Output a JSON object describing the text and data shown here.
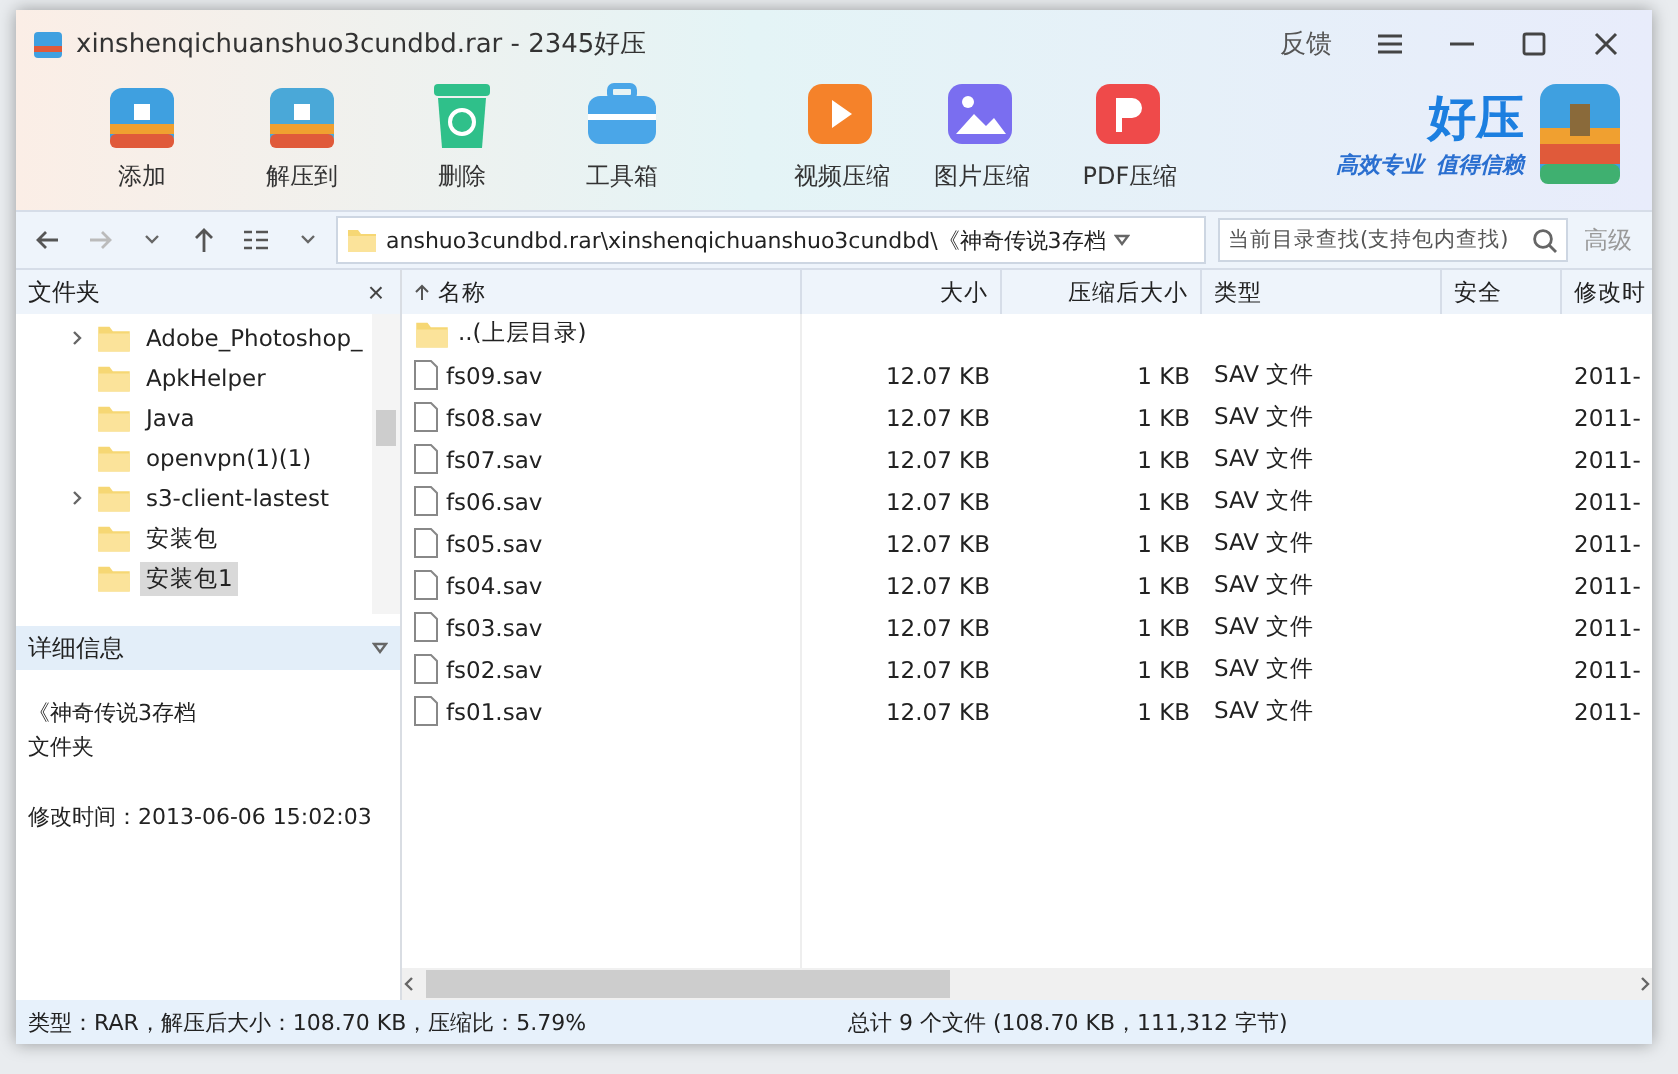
{
  "window": {
    "title": "xinshenqichuanshuo3cundbd.rar - 2345好压",
    "feedback": "反馈"
  },
  "toolbar": [
    {
      "label": "添加",
      "kind": "box",
      "color": "#3fa0e0"
    },
    {
      "label": "解压到",
      "kind": "box",
      "color": "#4aa8d8"
    },
    {
      "label": "删除",
      "kind": "bin",
      "color": "#2fc08a"
    },
    {
      "label": "工具箱",
      "kind": "case",
      "color": "#4aa6e8"
    },
    {
      "label": "视频压缩",
      "kind": "video",
      "color": "#f5822a"
    },
    {
      "label": "图片压缩",
      "kind": "image",
      "color": "#7a6ef0"
    },
    {
      "label": "PDF压缩",
      "kind": "pdf",
      "color": "#ef4a4a"
    }
  ],
  "brand": {
    "name": "好压",
    "slogan_1": "高效专业",
    "slogan_2": "值得信赖"
  },
  "address": {
    "path": "anshuo3cundbd.rar\\xinshenqichuanshuo3cundbd\\《神奇传说3存档",
    "search_placeholder": "当前目录查找(支持包内查找)",
    "advanced": "高级"
  },
  "folder_pane": {
    "title": "文件夹",
    "close": "×",
    "items": [
      {
        "label": "Adobe_Photoshop_",
        "expandable": true,
        "selected": false
      },
      {
        "label": "ApkHelper",
        "expandable": false,
        "selected": false
      },
      {
        "label": "Java",
        "expandable": false,
        "selected": false
      },
      {
        "label": "openvpn(1)(1)",
        "expandable": false,
        "selected": false
      },
      {
        "label": "s3-client-lastest",
        "expandable": true,
        "selected": false
      },
      {
        "label": "安装包",
        "expandable": false,
        "selected": false
      },
      {
        "label": "安装包1",
        "expandable": false,
        "selected": true
      }
    ]
  },
  "details": {
    "title": "详细信息",
    "name": "《神奇传说3存档",
    "type": "文件夹",
    "modified": "修改时间：2013-06-06 15:02:03"
  },
  "table": {
    "columns": [
      "名称",
      "大小",
      "压缩后大小",
      "类型",
      "安全",
      "修改时"
    ],
    "rows": [
      {
        "kind": "parent",
        "name": "..(上层目录)"
      },
      {
        "kind": "file",
        "name": "fs09.sav",
        "size": "12.07 KB",
        "packed": "1 KB",
        "type": "SAV 文件",
        "modified": "2011-"
      },
      {
        "kind": "file",
        "name": "fs08.sav",
        "size": "12.07 KB",
        "packed": "1 KB",
        "type": "SAV 文件",
        "modified": "2011-"
      },
      {
        "kind": "file",
        "name": "fs07.sav",
        "size": "12.07 KB",
        "packed": "1 KB",
        "type": "SAV 文件",
        "modified": "2011-"
      },
      {
        "kind": "file",
        "name": "fs06.sav",
        "size": "12.07 KB",
        "packed": "1 KB",
        "type": "SAV 文件",
        "modified": "2011-"
      },
      {
        "kind": "file",
        "name": "fs05.sav",
        "size": "12.07 KB",
        "packed": "1 KB",
        "type": "SAV 文件",
        "modified": "2011-"
      },
      {
        "kind": "file",
        "name": "fs04.sav",
        "size": "12.07 KB",
        "packed": "1 KB",
        "type": "SAV 文件",
        "modified": "2011-"
      },
      {
        "kind": "file",
        "name": "fs03.sav",
        "size": "12.07 KB",
        "packed": "1 KB",
        "type": "SAV 文件",
        "modified": "2011-"
      },
      {
        "kind": "file",
        "name": "fs02.sav",
        "size": "12.07 KB",
        "packed": "1 KB",
        "type": "SAV 文件",
        "modified": "2011-"
      },
      {
        "kind": "file",
        "name": "fs01.sav",
        "size": "12.07 KB",
        "packed": "1 KB",
        "type": "SAV 文件",
        "modified": "2011-"
      }
    ]
  },
  "status_bar": {
    "left": "类型：RAR，解压后大小：108.70 KB，压缩比：5.79%",
    "right": "总计 9 个文件 (108.70 KB，111,312 字节)"
  }
}
